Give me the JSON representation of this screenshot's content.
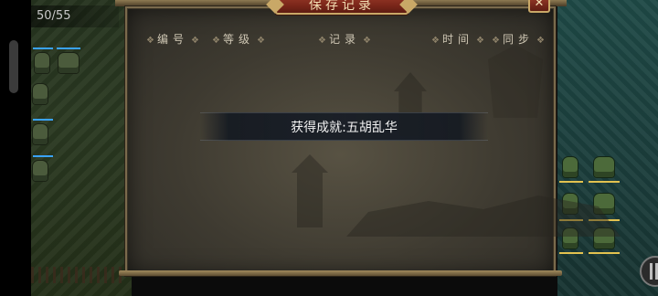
{
  "hud": {
    "unit_count": "50/55"
  },
  "dialog": {
    "title": "保存记录",
    "close_symbol": "✕",
    "columns": [
      "编号",
      "等级",
      "记录",
      "时间",
      "同步"
    ]
  },
  "toast": {
    "message": "获得成就:五胡乱华"
  },
  "colors": {
    "frame": "#7a6a4c",
    "plaque": "#7a2619",
    "gold": "#c9a867",
    "text": "#cfc7b4"
  }
}
